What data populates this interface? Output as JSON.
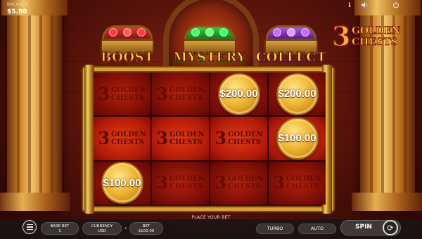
{
  "header": {
    "balance_label": "BALANCE",
    "balance_value": "$5.90",
    "icons": [
      "info-icon",
      "sound-icon",
      "power-icon"
    ]
  },
  "features": {
    "boost_label": "BOOST",
    "mystery_label": "MYSTERY",
    "collect_label": "COLLECT"
  },
  "logo": {
    "number": "3",
    "word1": "GOLDEN",
    "word2": "CHESTS"
  },
  "reels": {
    "ghost_number": "3",
    "ghost_word1": "GOLDEN",
    "ghost_word2": "CHESTS",
    "grid": [
      [
        {
          "type": "blank"
        },
        {
          "type": "blank"
        },
        {
          "type": "coin",
          "value": "$200.00"
        },
        {
          "type": "coin",
          "value": "$200.00"
        }
      ],
      [
        {
          "type": "blank"
        },
        {
          "type": "blank"
        },
        {
          "type": "blank"
        },
        {
          "type": "coin",
          "value": "$100.00"
        }
      ],
      [
        {
          "type": "coin",
          "value": "$100.00"
        },
        {
          "type": "blank"
        },
        {
          "type": "blank"
        },
        {
          "type": "blank"
        }
      ]
    ]
  },
  "footer": {
    "place_bet": "PLACE YOUR BET",
    "base_bet_label": "BASE BET",
    "base_bet_value": "1",
    "currency_label": "CURRENCY",
    "currency_value": "USD",
    "bet_label": "BET",
    "bet_value": "$100.00",
    "turbo_label": "TURBO",
    "auto_label": "AUTO",
    "spin_label": "SPIN"
  },
  "colors": {
    "frame_gold": "#d9a030",
    "reel_red": "#b5200c",
    "coin_gold": "#f0b834"
  }
}
